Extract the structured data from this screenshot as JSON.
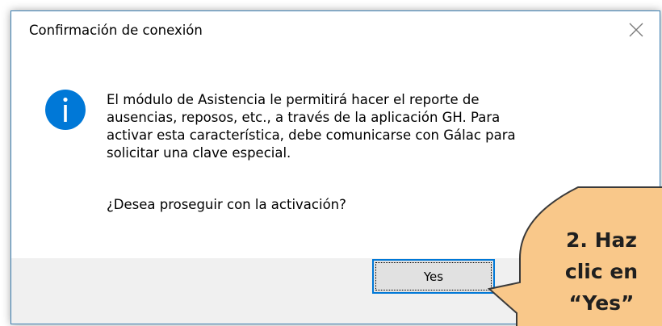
{
  "dialog": {
    "title": "Confirmación de conexión",
    "message_lines": [
      "El módulo de Asistencia le permitirá hacer el reporte de",
      "ausencias, reposos, etc., a través de la aplicación GH. Para",
      "activar esta característica, debe comunicarse con Gálac para",
      "solicitar una clave especial."
    ],
    "question": "¿Desea proseguir con la activación?",
    "icon": "info-icon",
    "buttons": {
      "yes_label": "Yes"
    }
  },
  "callout": {
    "lines": [
      "2. Haz",
      "clic en",
      "“Yes”"
    ],
    "fill_color": "#f9c88a",
    "border_color": "#3a3a3a"
  },
  "colors": {
    "info_icon": "#0078d7",
    "focus_border": "#0078d7",
    "footer_bg": "#f0f0f0"
  }
}
